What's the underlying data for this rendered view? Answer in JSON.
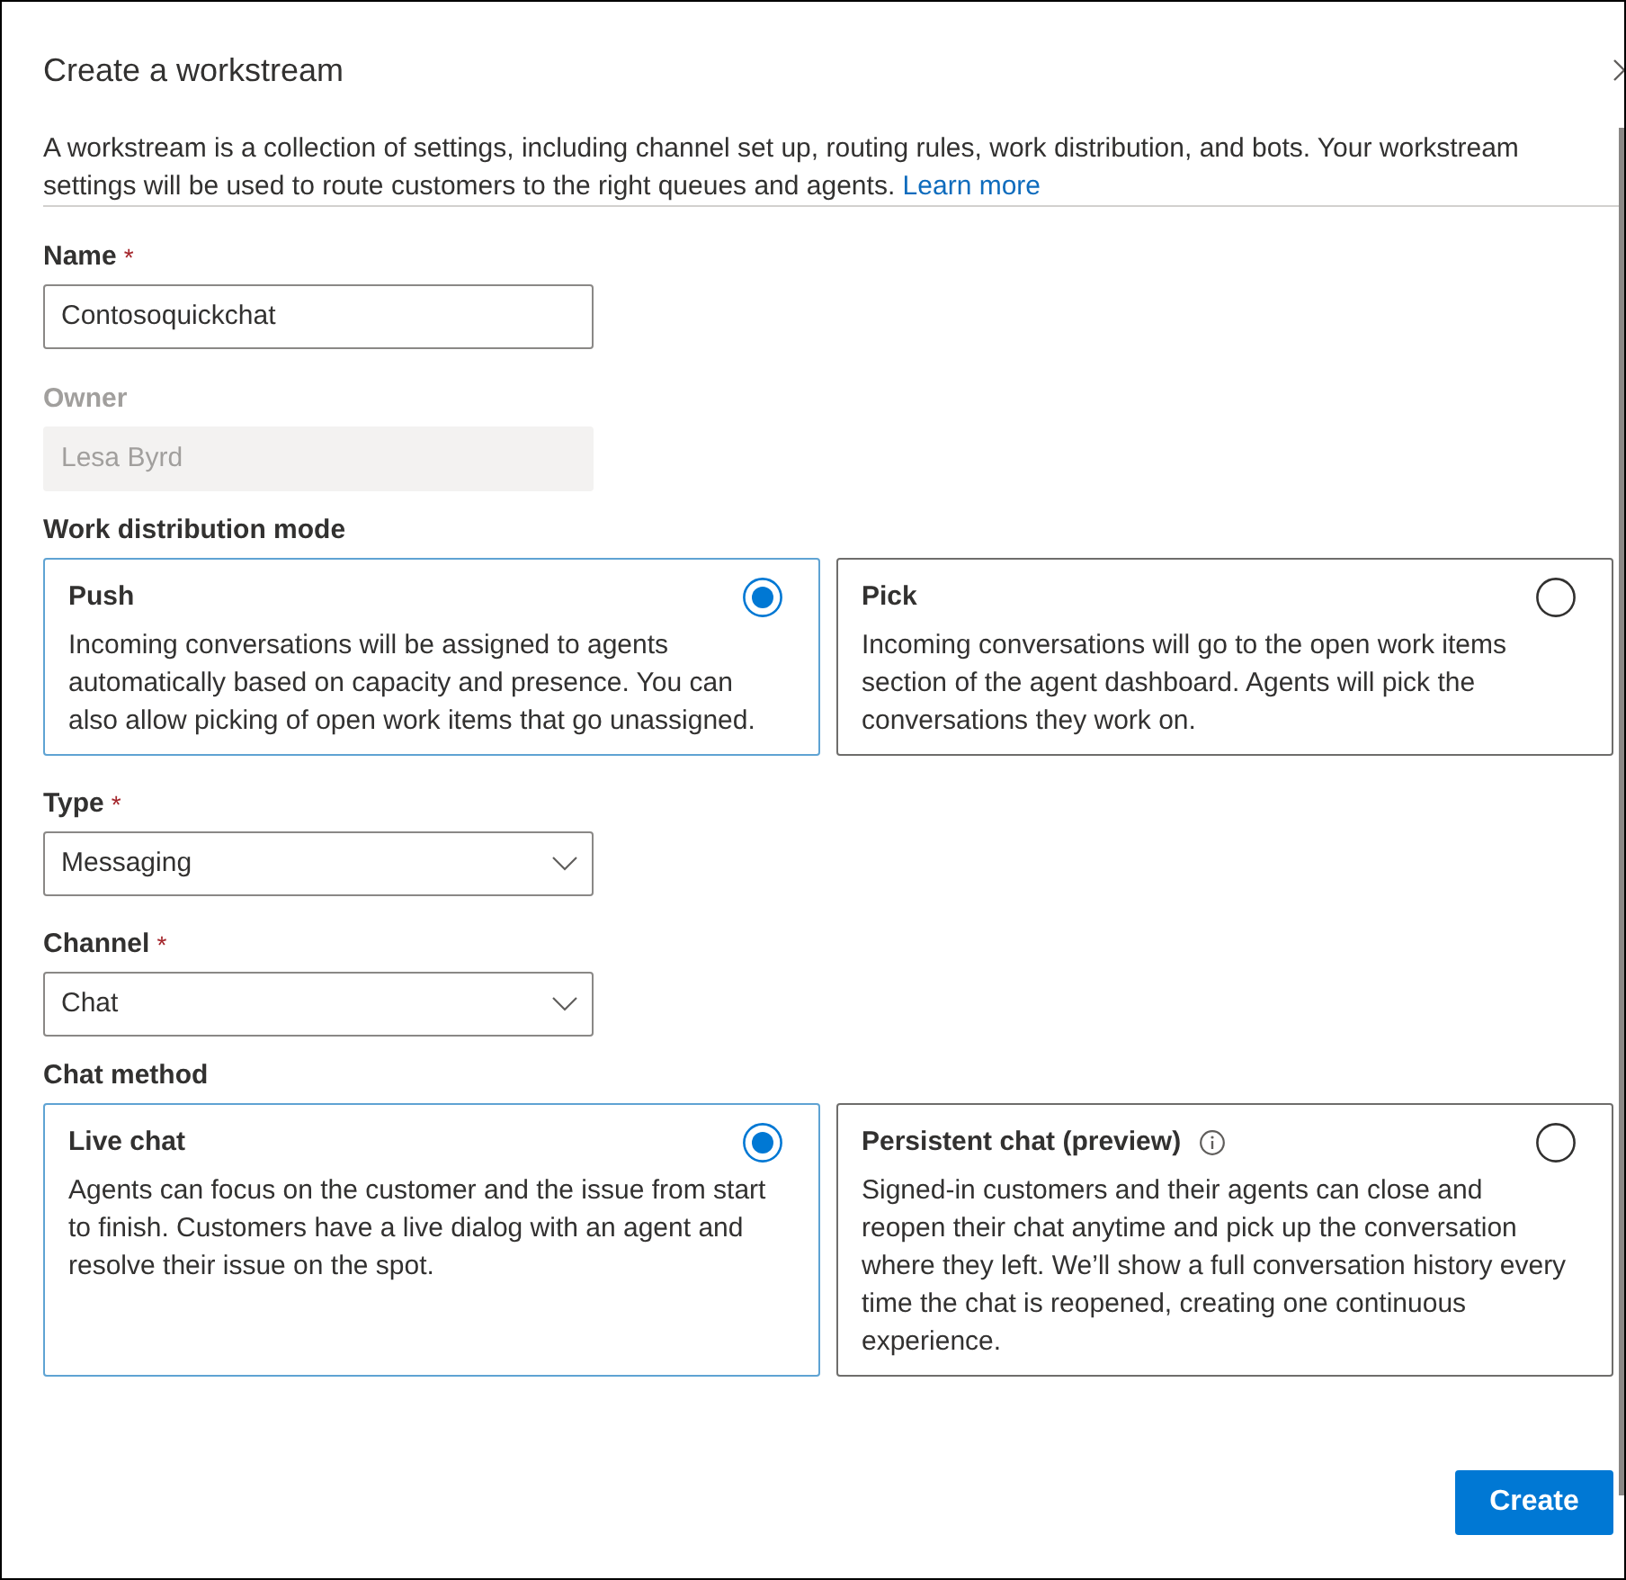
{
  "dialog": {
    "title": "Create a workstream",
    "description": "A workstream is a collection of settings, including channel set up, routing rules, work distribution, and bots. Your workstream settings will be used to route customers to the right queues and agents.",
    "link": "Learn more"
  },
  "form": [
    {
      "kind": "text",
      "label": "Name",
      "required_mark": "*",
      "value": "Contosoquickchat",
      "disabled": false
    },
    {
      "kind": "text",
      "label": "Owner",
      "value": "Lesa Byrd",
      "disabled": true
    },
    {
      "kind": "cards",
      "label": "Work distribution mode",
      "options": [
        {
          "title": "Push",
          "description": "Incoming conversations will be assigned to agents automatically based on capacity and presence. You can also allow picking of open work items that go unassigned.",
          "selected": true,
          "info_icon": false
        },
        {
          "title": "Pick",
          "description": "Incoming conversations will go to the open work items section of the agent dashboard. Agents will pick the conversations they work on.",
          "selected": false,
          "info_icon": false
        }
      ]
    },
    {
      "kind": "select",
      "label": "Type",
      "required_mark": "*",
      "value": "Messaging"
    },
    {
      "kind": "select",
      "label": "Channel",
      "required_mark": "*",
      "value": "Chat"
    },
    {
      "kind": "cards",
      "label": "Chat method",
      "options": [
        {
          "title": "Live chat",
          "description": "Agents can focus on the customer and the issue from start to finish. Customers have a live dialog with an agent and resolve their issue on the spot.",
          "selected": true,
          "info_icon": false
        },
        {
          "title": "Persistent chat (preview)",
          "description": "Signed-in customers and their agents can close and reopen their chat anytime and pick up the conversation where they left. We’ll show a full conversation history every time the chat is reopened, creating one continuous experience.",
          "selected": false,
          "info_icon": true
        }
      ]
    }
  ],
  "buttons": [
    {
      "label": "Create",
      "kind": "primary"
    }
  ]
}
